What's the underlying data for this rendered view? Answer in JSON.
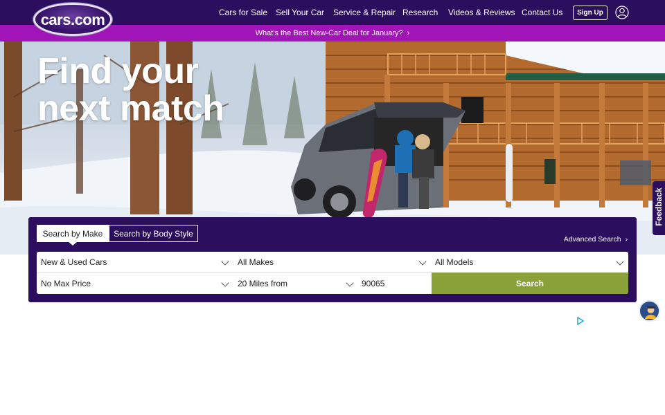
{
  "header": {
    "logo_text": "cars.com",
    "nav": [
      "Cars for Sale",
      "Sell Your Car",
      "Service & Repair",
      "Research",
      "Videos & Reviews",
      "Contact Us"
    ],
    "signup_label": "Sign Up",
    "colors": {
      "background": "#2c0e5f",
      "text": "#ffffff"
    },
    "user_icon": "user-circle-icon"
  },
  "promo": {
    "text": "What's the Best New-Car Deal for January?",
    "chevron": "›",
    "background": "#a114b8"
  },
  "hero": {
    "title_line1": "Find your",
    "title_line2": "next match"
  },
  "feedback": {
    "label": "Feedback"
  },
  "search": {
    "tabs": [
      {
        "label": "Search by Make",
        "active": true
      },
      {
        "label": "Search by Body Style",
        "active": false
      }
    ],
    "advanced_search": "Advanced Search",
    "stock_type": "New & Used Cars",
    "make": "All Makes",
    "model": "All Models",
    "price": "No Max Price",
    "distance": "20 Miles from",
    "zip": "90065",
    "search_button": "Search",
    "button_color": "#8aa13a"
  },
  "chat": {
    "icon": "chat-assistant-icon"
  },
  "ad": {
    "icon": "adchoices-icon"
  }
}
